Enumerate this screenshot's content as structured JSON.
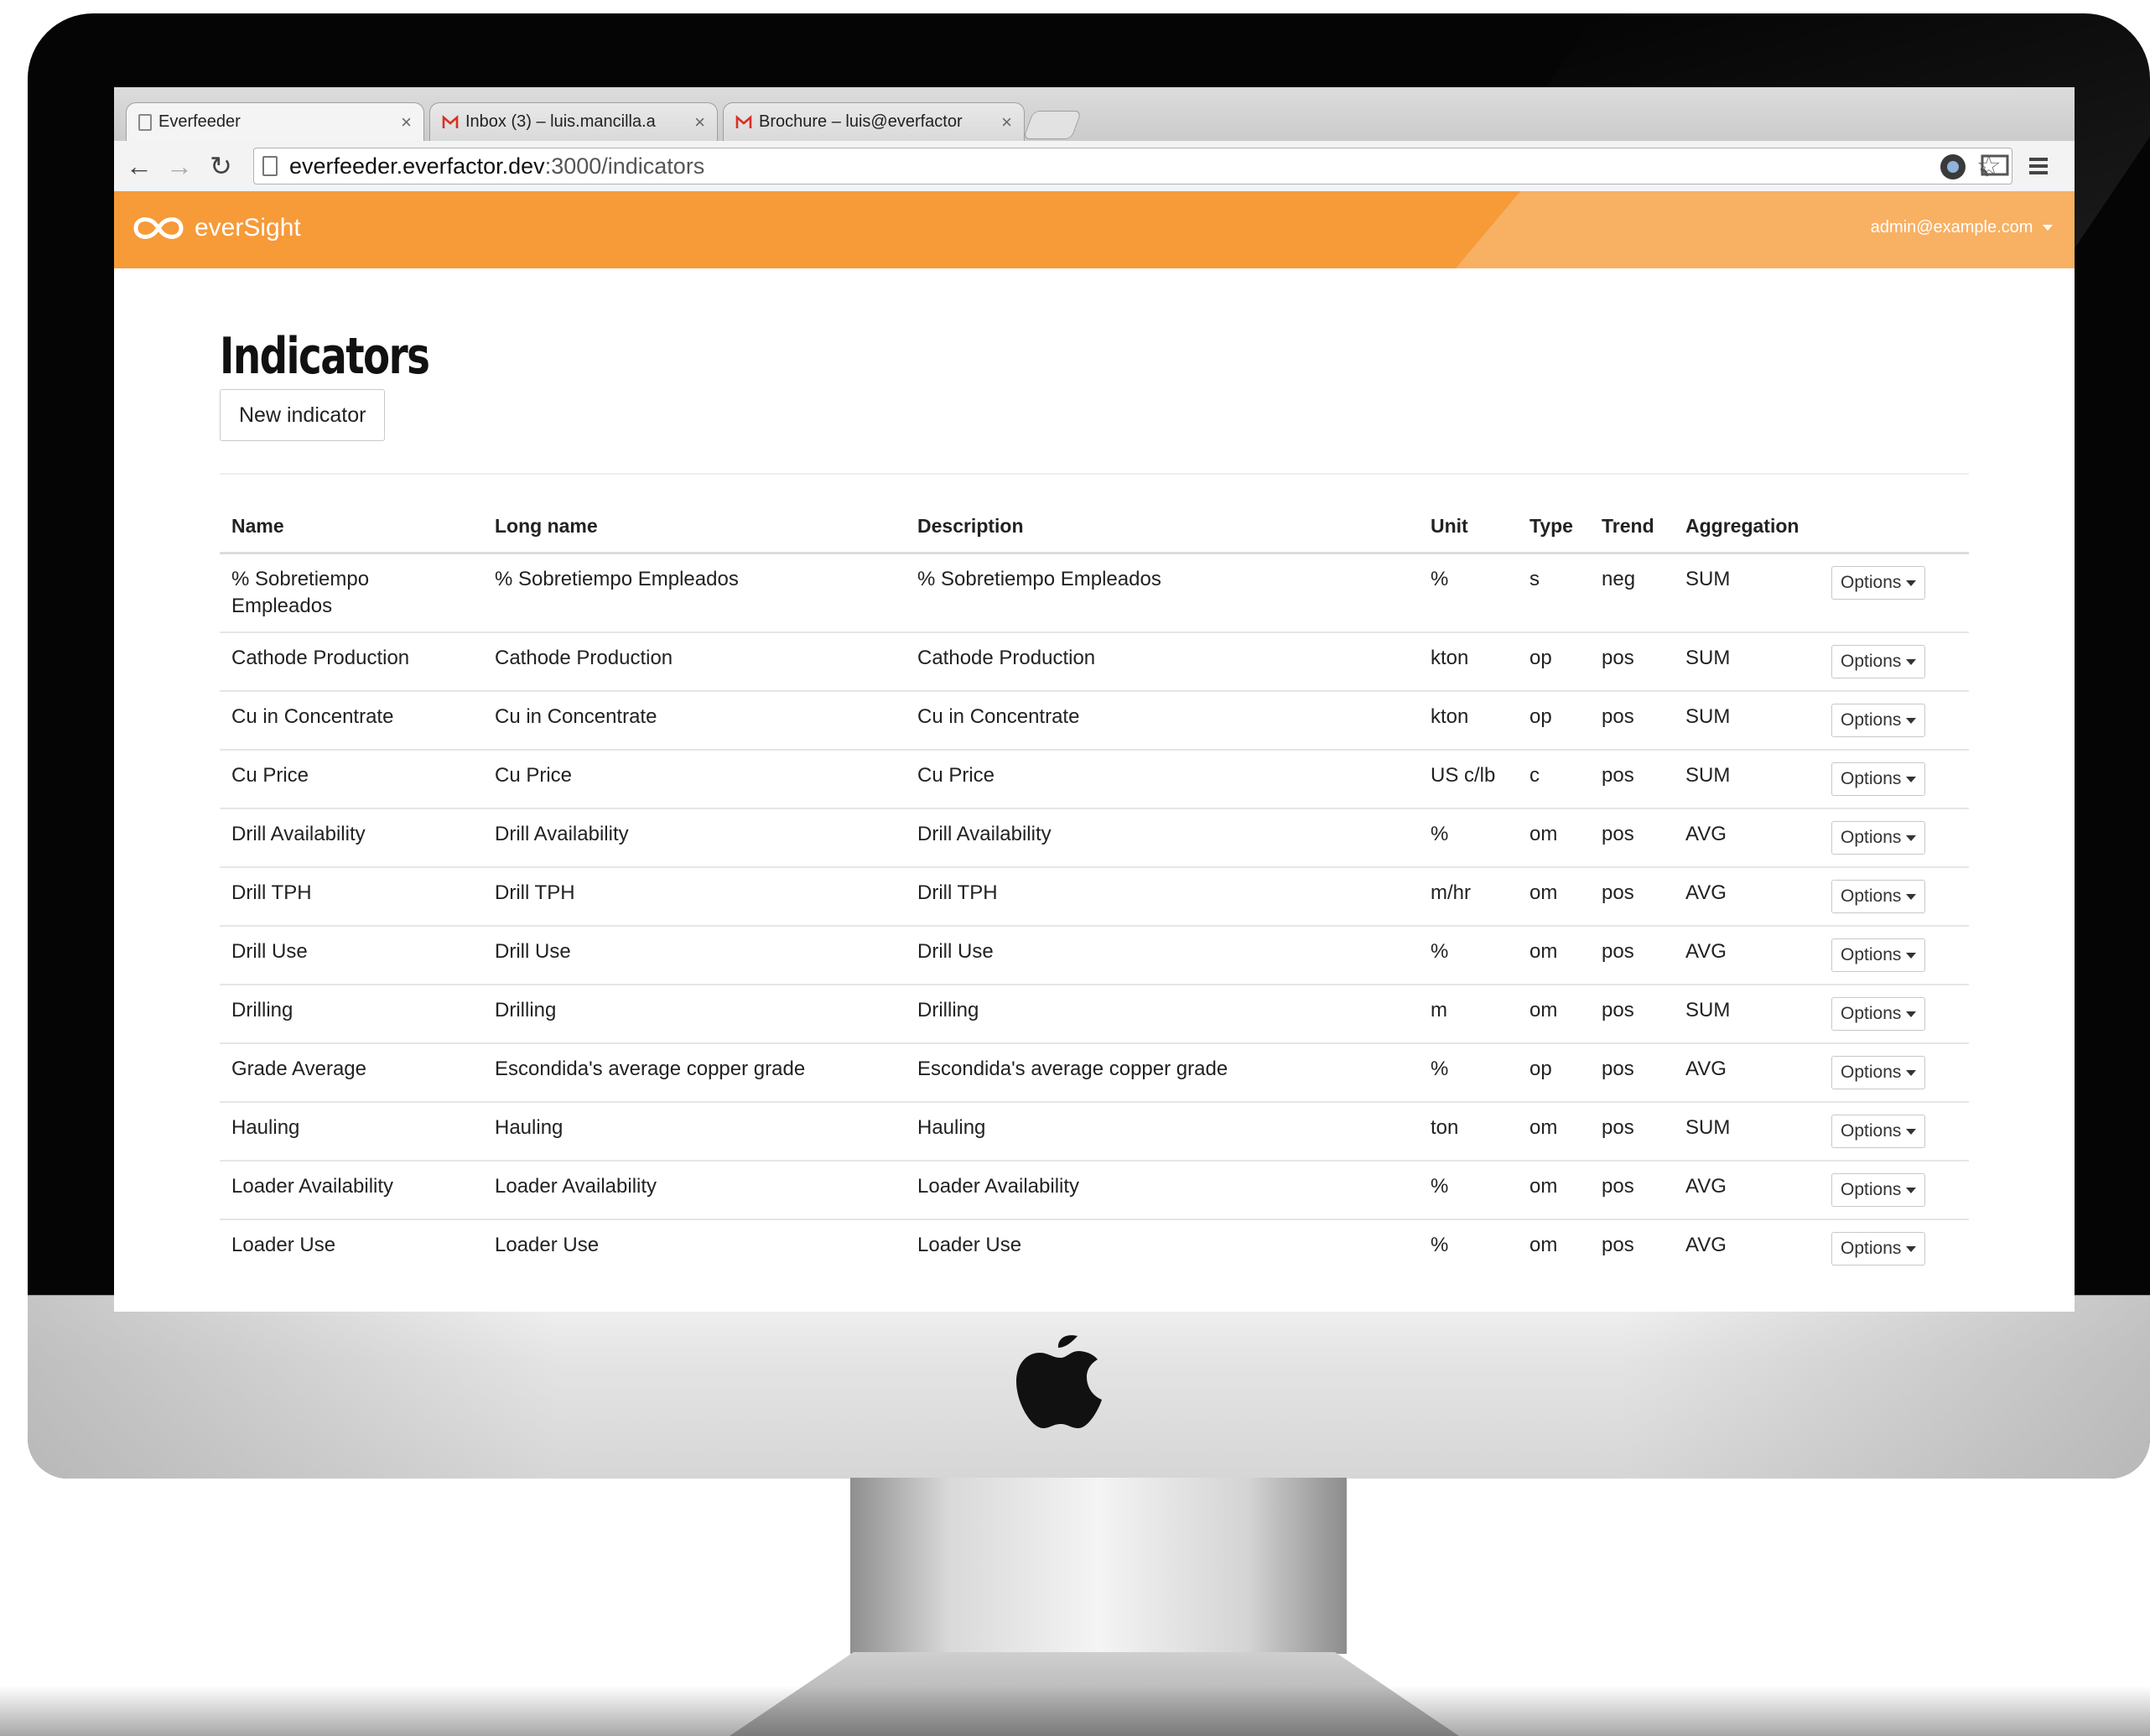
{
  "browser": {
    "tabs": [
      {
        "title": "Everfeeder",
        "close": "×"
      },
      {
        "title": "Inbox (3) – luis.mancilla.a",
        "close": "×"
      },
      {
        "title": "Brochure – luis@everfactor",
        "close": "×"
      }
    ],
    "url_host": "everfeeder.everfactor.dev",
    "url_path": ":3000/indicators"
  },
  "app": {
    "brand": "everSight",
    "user_email": "admin@example.com",
    "page_title": "Indicators",
    "new_button": "New indicator",
    "accent_color": "#f79a38"
  },
  "table": {
    "headers": [
      "Name",
      "Long name",
      "Description",
      "Unit",
      "Type",
      "Trend",
      "Aggregation"
    ],
    "options_label": "Options",
    "rows": [
      {
        "name": "% Sobretiempo Empleados",
        "long_name": "% Sobretiempo Empleados",
        "description": "% Sobretiempo Empleados",
        "unit": "%",
        "type": "s",
        "trend": "neg",
        "aggregation": "SUM"
      },
      {
        "name": "Cathode Production",
        "long_name": "Cathode Production",
        "description": "Cathode Production",
        "unit": "kton",
        "type": "op",
        "trend": "pos",
        "aggregation": "SUM"
      },
      {
        "name": "Cu in Concentrate",
        "long_name": "Cu in Concentrate",
        "description": "Cu in Concentrate",
        "unit": "kton",
        "type": "op",
        "trend": "pos",
        "aggregation": "SUM"
      },
      {
        "name": "Cu Price",
        "long_name": "Cu Price",
        "description": "Cu Price",
        "unit": "US c/lb",
        "type": "c",
        "trend": "pos",
        "aggregation": "SUM"
      },
      {
        "name": "Drill Availability",
        "long_name": "Drill Availability",
        "description": "Drill Availability",
        "unit": "%",
        "type": "om",
        "trend": "pos",
        "aggregation": "AVG"
      },
      {
        "name": "Drill TPH",
        "long_name": "Drill TPH",
        "description": "Drill TPH",
        "unit": "m/hr",
        "type": "om",
        "trend": "pos",
        "aggregation": "AVG"
      },
      {
        "name": "Drill Use",
        "long_name": "Drill Use",
        "description": "Drill Use",
        "unit": "%",
        "type": "om",
        "trend": "pos",
        "aggregation": "AVG"
      },
      {
        "name": "Drilling",
        "long_name": "Drilling",
        "description": "Drilling",
        "unit": "m",
        "type": "om",
        "trend": "pos",
        "aggregation": "SUM"
      },
      {
        "name": "Grade Average",
        "long_name": "Escondida's average copper grade",
        "description": "Escondida's average copper grade",
        "unit": "%",
        "type": "op",
        "trend": "pos",
        "aggregation": "AVG"
      },
      {
        "name": "Hauling",
        "long_name": "Hauling",
        "description": "Hauling",
        "unit": "ton",
        "type": "om",
        "trend": "pos",
        "aggregation": "SUM"
      },
      {
        "name": "Loader Availability",
        "long_name": "Loader Availability",
        "description": "Loader Availability",
        "unit": "%",
        "type": "om",
        "trend": "pos",
        "aggregation": "AVG"
      },
      {
        "name": "Loader Use",
        "long_name": "Loader Use",
        "description": "Loader Use",
        "unit": "%",
        "type": "om",
        "trend": "pos",
        "aggregation": "AVG"
      }
    ]
  }
}
